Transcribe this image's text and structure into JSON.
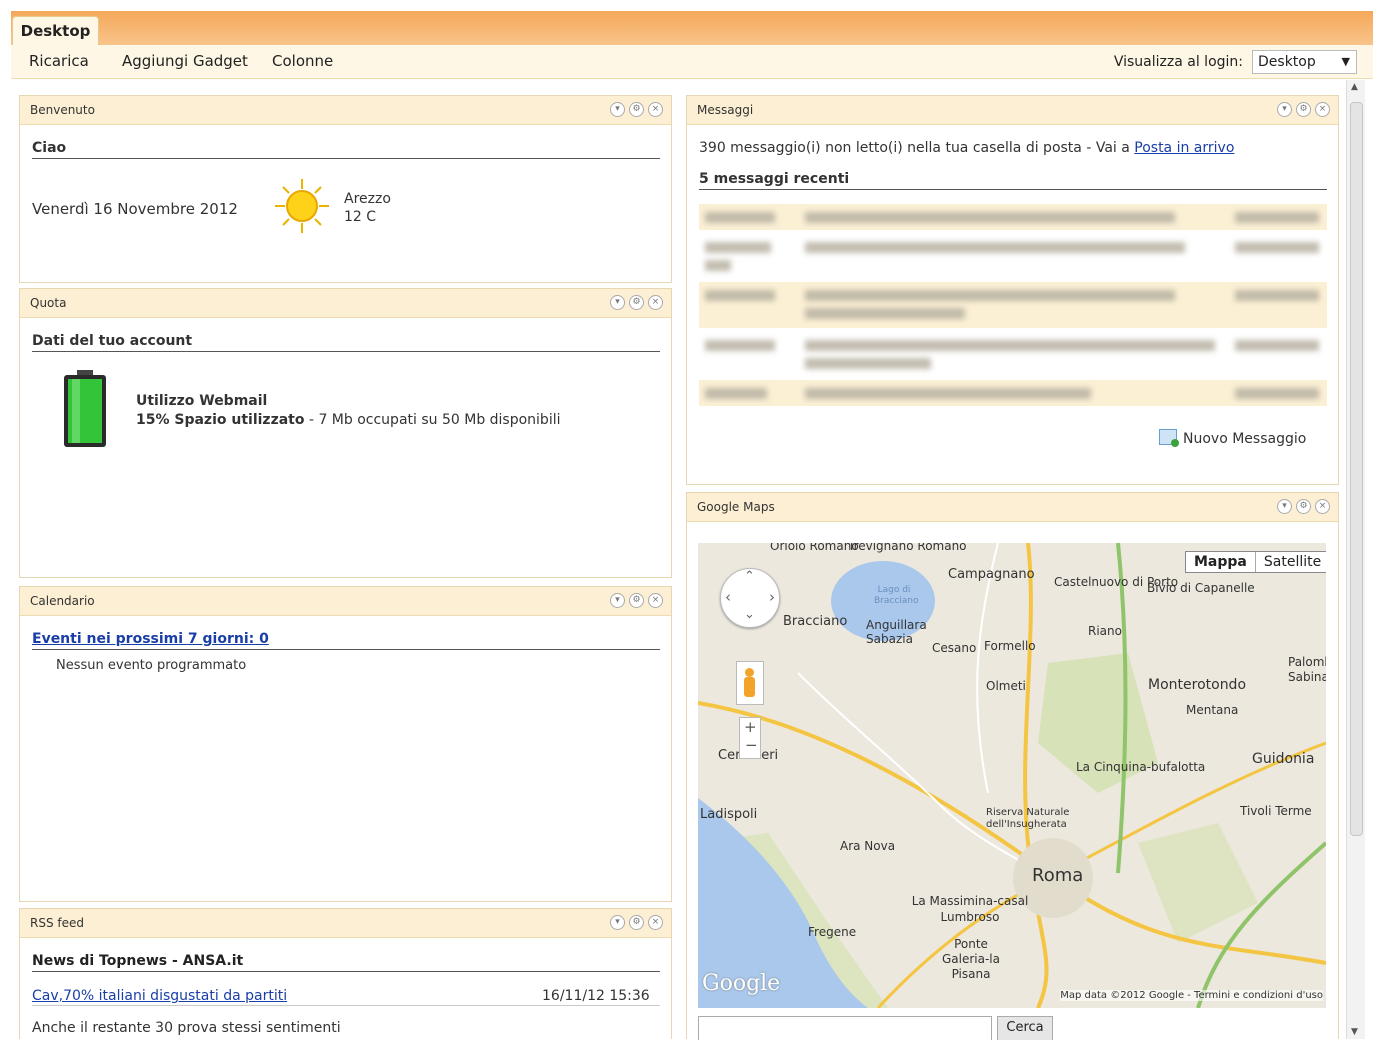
{
  "tab": {
    "label": "Desktop"
  },
  "toolbar": {
    "reload": "Ricarica",
    "add_gadget": "Aggiungi Gadget",
    "columns": "Colonne",
    "login_label": "Visualizza al login:",
    "login_value": "Desktop"
  },
  "welcome": {
    "title": "Benvenuto",
    "greeting": "Ciao",
    "date": "Venerdì 16 Novembre 2012",
    "city": "Arezzo",
    "temp": "12 C"
  },
  "quota": {
    "title": "Quota",
    "section": "Dati del tuo account",
    "usage_title": "Utilizzo Webmail",
    "usage_pct": "15% Spazio utilizzato",
    "usage_detail": " - 7 Mb occupati su 50 Mb disponibili",
    "used_fraction": 0.15
  },
  "calendar": {
    "title": "Calendario",
    "events_link": "Eventi nei prossimi 7 giorni: 0",
    "none": "Nessun evento programmato"
  },
  "rss": {
    "title": "RSS feed",
    "source": "News di Topnews - ANSA.it",
    "item_title": "Cav,70% italiani disgustati da partiti",
    "item_date": "16/11/12 15:36",
    "item_desc": "Anche il restante 30 prova stessi sentimenti"
  },
  "messages": {
    "title": "Messaggi",
    "unread_text": "390 messaggio(i) non letto(i) nella tua casella di posta - Vai a ",
    "inbox_link": "Posta in arrivo",
    "recent_title": "5 messaggi recenti",
    "new_message": "Nuovo Messaggio"
  },
  "maps": {
    "title": "Google Maps",
    "btn_map": "Mappa",
    "btn_satellite": "Satellite",
    "logo": "Google",
    "attribution": "Map data ©2012 Google - Termini e condizioni d'uso",
    "search_button": "Cerca",
    "places": [
      "Oriolo Romano",
      "Trevignano Romano",
      "Campagnano",
      "Castelnuovo di Porto",
      "Bivio di Capanelle",
      "Riano",
      "Bracciano",
      "Anguillara Sabazia",
      "Cesano",
      "Formello",
      "Olmeti",
      "Monterotondo",
      "Mentana",
      "Guidonia",
      "La Cinquina-bufalotta",
      "Cerveteri",
      "Ladispoli",
      "Riserva Naturale dell'Insugherata",
      "Tivoli Terme",
      "Ara Nova",
      "Roma",
      "La Massimina-casal Lumbroso",
      "Fregene",
      "Ponte Galeria-la Pisana",
      "Lago di Bracciano",
      "Palombara Sabina"
    ]
  }
}
